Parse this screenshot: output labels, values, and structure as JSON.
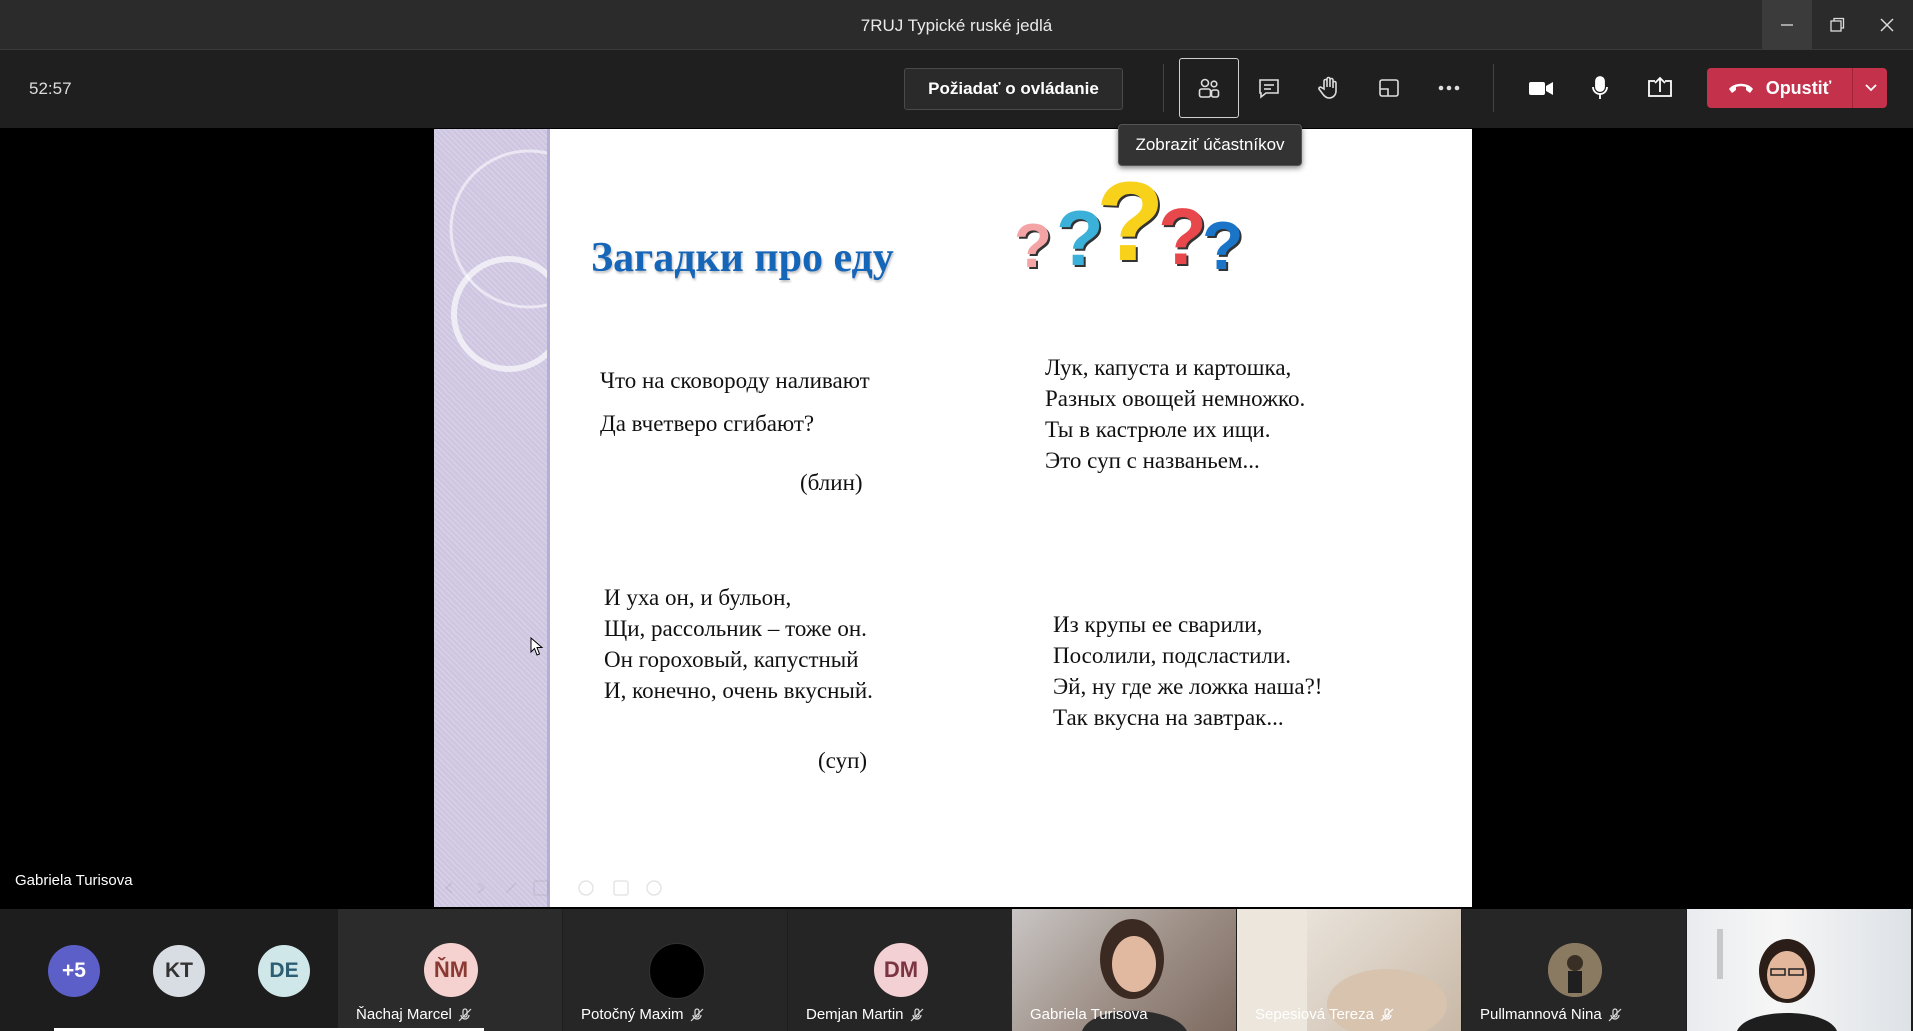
{
  "window": {
    "title": "7RUJ Typické ruské jedlá"
  },
  "toolbar": {
    "timer": "52:57",
    "request_control_label": "Požiadať o ovládanie",
    "leave_label": "Opustiť",
    "tooltip": "Zobraziť účastníkov",
    "icons": [
      "participants-icon",
      "chat-icon",
      "raise-hand-icon",
      "rooms-icon",
      "more-icon",
      "camera-icon",
      "mic-icon",
      "share-icon"
    ]
  },
  "slide": {
    "title": "Загадки про еду",
    "riddle1": {
      "lines": [
        "Что на сковороду наливают",
        "Да вчетверо сгибают?"
      ],
      "answer": "(блин)"
    },
    "riddle2": {
      "lines": [
        "Лук, капуста и картошка,",
        "Разных овощей немножко.",
        "Ты в кастрюле их ищи.",
        "Это суп с названьем..."
      ]
    },
    "riddle3": {
      "lines": [
        "И уха он, и бульон,",
        "Щи, рассольник – тоже он.",
        "Он гороховый, капустный",
        "И, конечно, очень вкусный."
      ],
      "answer": "(суп)"
    },
    "riddle4": {
      "lines": [
        "Из крупы ее сварили,",
        "Посолили, подсластили.",
        "Эй, ну где же ложка наша?!",
        "Так вкусна на завтрак..."
      ]
    },
    "question_marks": [
      "?",
      "?",
      "?",
      "?",
      "?"
    ],
    "colors": {
      "title": "#1565b8",
      "qm_pink": "#f4a4a4",
      "qm_blue": "#3bb0d8",
      "qm_yellow": "#f8d21a",
      "qm_red": "#e8474b",
      "qm_dark_blue": "#1a75c9"
    }
  },
  "speaker": {
    "name": "Gabriela Turisova"
  },
  "participants": {
    "more_count": "+5",
    "circles": [
      "KT",
      "DE"
    ],
    "tiles": [
      {
        "name": "Ňachaj Marcel",
        "initials": "ŇM"
      },
      {
        "name": "Potočný Maxim",
        "initials": ""
      },
      {
        "name": "Demjan Martin",
        "initials": "DM"
      },
      {
        "name": "Gabriela Turisova",
        "initials": ""
      },
      {
        "name": "Sepesiová Tereza",
        "initials": ""
      },
      {
        "name": "Pullmannová Nina",
        "initials": ""
      },
      {
        "name": "",
        "initials": ""
      }
    ]
  }
}
